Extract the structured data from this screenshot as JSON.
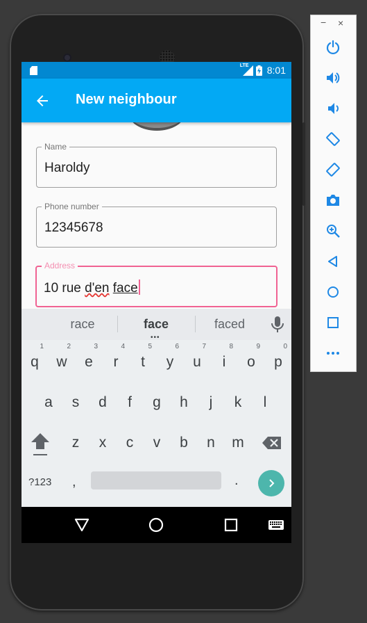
{
  "status_bar": {
    "network": "LTE",
    "time": "8:01"
  },
  "app_bar": {
    "title": "New neighbour",
    "back_icon": "arrow-back-icon"
  },
  "form": {
    "name": {
      "label": "Name",
      "value": "Haroldy"
    },
    "phone": {
      "label": "Phone number",
      "value": "12345678"
    },
    "address": {
      "label": "Address",
      "value_plain": "10 rue ",
      "value_misspelled": "d'en",
      "value_space": " ",
      "value_composing": "face"
    }
  },
  "keyboard": {
    "suggestions": [
      "race",
      "face",
      "faced"
    ],
    "row1": [
      {
        "key": "q",
        "hint": "1"
      },
      {
        "key": "w",
        "hint": "2"
      },
      {
        "key": "e",
        "hint": "3"
      },
      {
        "key": "r",
        "hint": "4"
      },
      {
        "key": "t",
        "hint": "5"
      },
      {
        "key": "y",
        "hint": "6"
      },
      {
        "key": "u",
        "hint": "7"
      },
      {
        "key": "i",
        "hint": "8"
      },
      {
        "key": "o",
        "hint": "9"
      },
      {
        "key": "p",
        "hint": "0"
      }
    ],
    "row2": [
      "a",
      "s",
      "d",
      "f",
      "g",
      "h",
      "j",
      "k",
      "l"
    ],
    "row3": [
      "z",
      "x",
      "c",
      "v",
      "b",
      "n",
      "m"
    ],
    "symbols_label": "?123",
    "comma": ",",
    "period": "."
  },
  "colors": {
    "status_bar": "#0288d1",
    "app_bar": "#03a9f4",
    "focused_field": "#f06292",
    "enter_key": "#4db6ac"
  },
  "emulator_toolbar": {
    "minimize": "−",
    "close": "×",
    "buttons": [
      "power-icon",
      "volume-up-icon",
      "volume-down-icon",
      "rotate-left-icon",
      "rotate-right-icon",
      "camera-icon",
      "zoom-icon",
      "back-icon",
      "home-icon",
      "overview-icon",
      "more-icon"
    ]
  }
}
